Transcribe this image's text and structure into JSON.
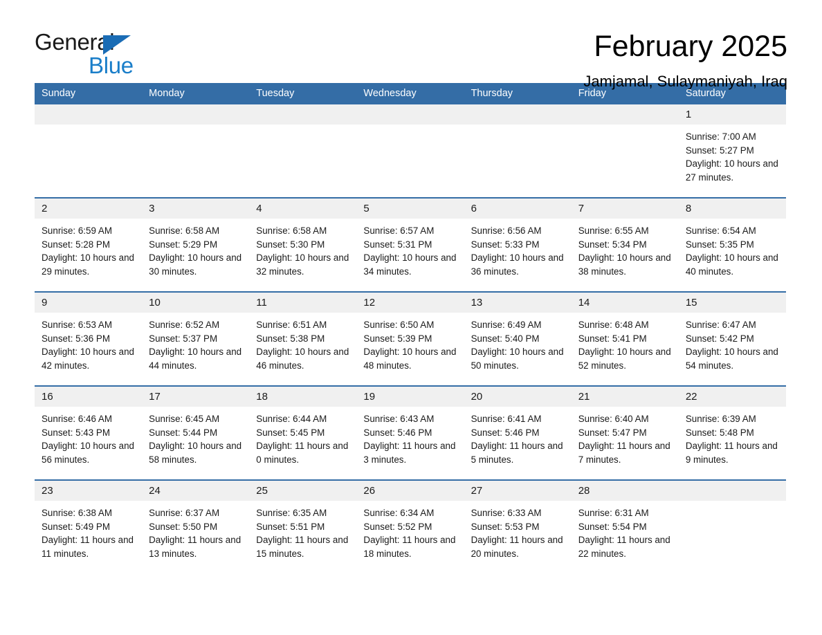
{
  "brand": {
    "name_part1": "General",
    "name_part2": "Blue",
    "triangle_icon": "triangle-icon",
    "accent_color": "#1a7ec9"
  },
  "header": {
    "title": "February 2025",
    "subtitle": "Jamjamal, Sulaymaniyah, Iraq"
  },
  "theme": {
    "header_blue": "#346da6",
    "daynum_gray": "#f0f0f0",
    "logo_blue": "#1a7ec9"
  },
  "calendar": {
    "weekdays": [
      "Sunday",
      "Monday",
      "Tuesday",
      "Wednesday",
      "Thursday",
      "Friday",
      "Saturday"
    ],
    "weeks": [
      [
        {
          "day": "",
          "empty": true
        },
        {
          "day": "",
          "empty": true
        },
        {
          "day": "",
          "empty": true
        },
        {
          "day": "",
          "empty": true
        },
        {
          "day": "",
          "empty": true
        },
        {
          "day": "",
          "empty": true
        },
        {
          "day": "1",
          "sunrise": "Sunrise: 7:00 AM",
          "sunset": "Sunset: 5:27 PM",
          "daylight": "Daylight: 10 hours and 27 minutes."
        }
      ],
      [
        {
          "day": "2",
          "sunrise": "Sunrise: 6:59 AM",
          "sunset": "Sunset: 5:28 PM",
          "daylight": "Daylight: 10 hours and 29 minutes."
        },
        {
          "day": "3",
          "sunrise": "Sunrise: 6:58 AM",
          "sunset": "Sunset: 5:29 PM",
          "daylight": "Daylight: 10 hours and 30 minutes."
        },
        {
          "day": "4",
          "sunrise": "Sunrise: 6:58 AM",
          "sunset": "Sunset: 5:30 PM",
          "daylight": "Daylight: 10 hours and 32 minutes."
        },
        {
          "day": "5",
          "sunrise": "Sunrise: 6:57 AM",
          "sunset": "Sunset: 5:31 PM",
          "daylight": "Daylight: 10 hours and 34 minutes."
        },
        {
          "day": "6",
          "sunrise": "Sunrise: 6:56 AM",
          "sunset": "Sunset: 5:33 PM",
          "daylight": "Daylight: 10 hours and 36 minutes."
        },
        {
          "day": "7",
          "sunrise": "Sunrise: 6:55 AM",
          "sunset": "Sunset: 5:34 PM",
          "daylight": "Daylight: 10 hours and 38 minutes."
        },
        {
          "day": "8",
          "sunrise": "Sunrise: 6:54 AM",
          "sunset": "Sunset: 5:35 PM",
          "daylight": "Daylight: 10 hours and 40 minutes."
        }
      ],
      [
        {
          "day": "9",
          "sunrise": "Sunrise: 6:53 AM",
          "sunset": "Sunset: 5:36 PM",
          "daylight": "Daylight: 10 hours and 42 minutes."
        },
        {
          "day": "10",
          "sunrise": "Sunrise: 6:52 AM",
          "sunset": "Sunset: 5:37 PM",
          "daylight": "Daylight: 10 hours and 44 minutes."
        },
        {
          "day": "11",
          "sunrise": "Sunrise: 6:51 AM",
          "sunset": "Sunset: 5:38 PM",
          "daylight": "Daylight: 10 hours and 46 minutes."
        },
        {
          "day": "12",
          "sunrise": "Sunrise: 6:50 AM",
          "sunset": "Sunset: 5:39 PM",
          "daylight": "Daylight: 10 hours and 48 minutes."
        },
        {
          "day": "13",
          "sunrise": "Sunrise: 6:49 AM",
          "sunset": "Sunset: 5:40 PM",
          "daylight": "Daylight: 10 hours and 50 minutes."
        },
        {
          "day": "14",
          "sunrise": "Sunrise: 6:48 AM",
          "sunset": "Sunset: 5:41 PM",
          "daylight": "Daylight: 10 hours and 52 minutes."
        },
        {
          "day": "15",
          "sunrise": "Sunrise: 6:47 AM",
          "sunset": "Sunset: 5:42 PM",
          "daylight": "Daylight: 10 hours and 54 minutes."
        }
      ],
      [
        {
          "day": "16",
          "sunrise": "Sunrise: 6:46 AM",
          "sunset": "Sunset: 5:43 PM",
          "daylight": "Daylight: 10 hours and 56 minutes."
        },
        {
          "day": "17",
          "sunrise": "Sunrise: 6:45 AM",
          "sunset": "Sunset: 5:44 PM",
          "daylight": "Daylight: 10 hours and 58 minutes."
        },
        {
          "day": "18",
          "sunrise": "Sunrise: 6:44 AM",
          "sunset": "Sunset: 5:45 PM",
          "daylight": "Daylight: 11 hours and 0 minutes."
        },
        {
          "day": "19",
          "sunrise": "Sunrise: 6:43 AM",
          "sunset": "Sunset: 5:46 PM",
          "daylight": "Daylight: 11 hours and 3 minutes."
        },
        {
          "day": "20",
          "sunrise": "Sunrise: 6:41 AM",
          "sunset": "Sunset: 5:46 PM",
          "daylight": "Daylight: 11 hours and 5 minutes."
        },
        {
          "day": "21",
          "sunrise": "Sunrise: 6:40 AM",
          "sunset": "Sunset: 5:47 PM",
          "daylight": "Daylight: 11 hours and 7 minutes."
        },
        {
          "day": "22",
          "sunrise": "Sunrise: 6:39 AM",
          "sunset": "Sunset: 5:48 PM",
          "daylight": "Daylight: 11 hours and 9 minutes."
        }
      ],
      [
        {
          "day": "23",
          "sunrise": "Sunrise: 6:38 AM",
          "sunset": "Sunset: 5:49 PM",
          "daylight": "Daylight: 11 hours and 11 minutes."
        },
        {
          "day": "24",
          "sunrise": "Sunrise: 6:37 AM",
          "sunset": "Sunset: 5:50 PM",
          "daylight": "Daylight: 11 hours and 13 minutes."
        },
        {
          "day": "25",
          "sunrise": "Sunrise: 6:35 AM",
          "sunset": "Sunset: 5:51 PM",
          "daylight": "Daylight: 11 hours and 15 minutes."
        },
        {
          "day": "26",
          "sunrise": "Sunrise: 6:34 AM",
          "sunset": "Sunset: 5:52 PM",
          "daylight": "Daylight: 11 hours and 18 minutes."
        },
        {
          "day": "27",
          "sunrise": "Sunrise: 6:33 AM",
          "sunset": "Sunset: 5:53 PM",
          "daylight": "Daylight: 11 hours and 20 minutes."
        },
        {
          "day": "28",
          "sunrise": "Sunrise: 6:31 AM",
          "sunset": "Sunset: 5:54 PM",
          "daylight": "Daylight: 11 hours and 22 minutes."
        },
        {
          "day": "",
          "empty": true
        }
      ]
    ]
  }
}
